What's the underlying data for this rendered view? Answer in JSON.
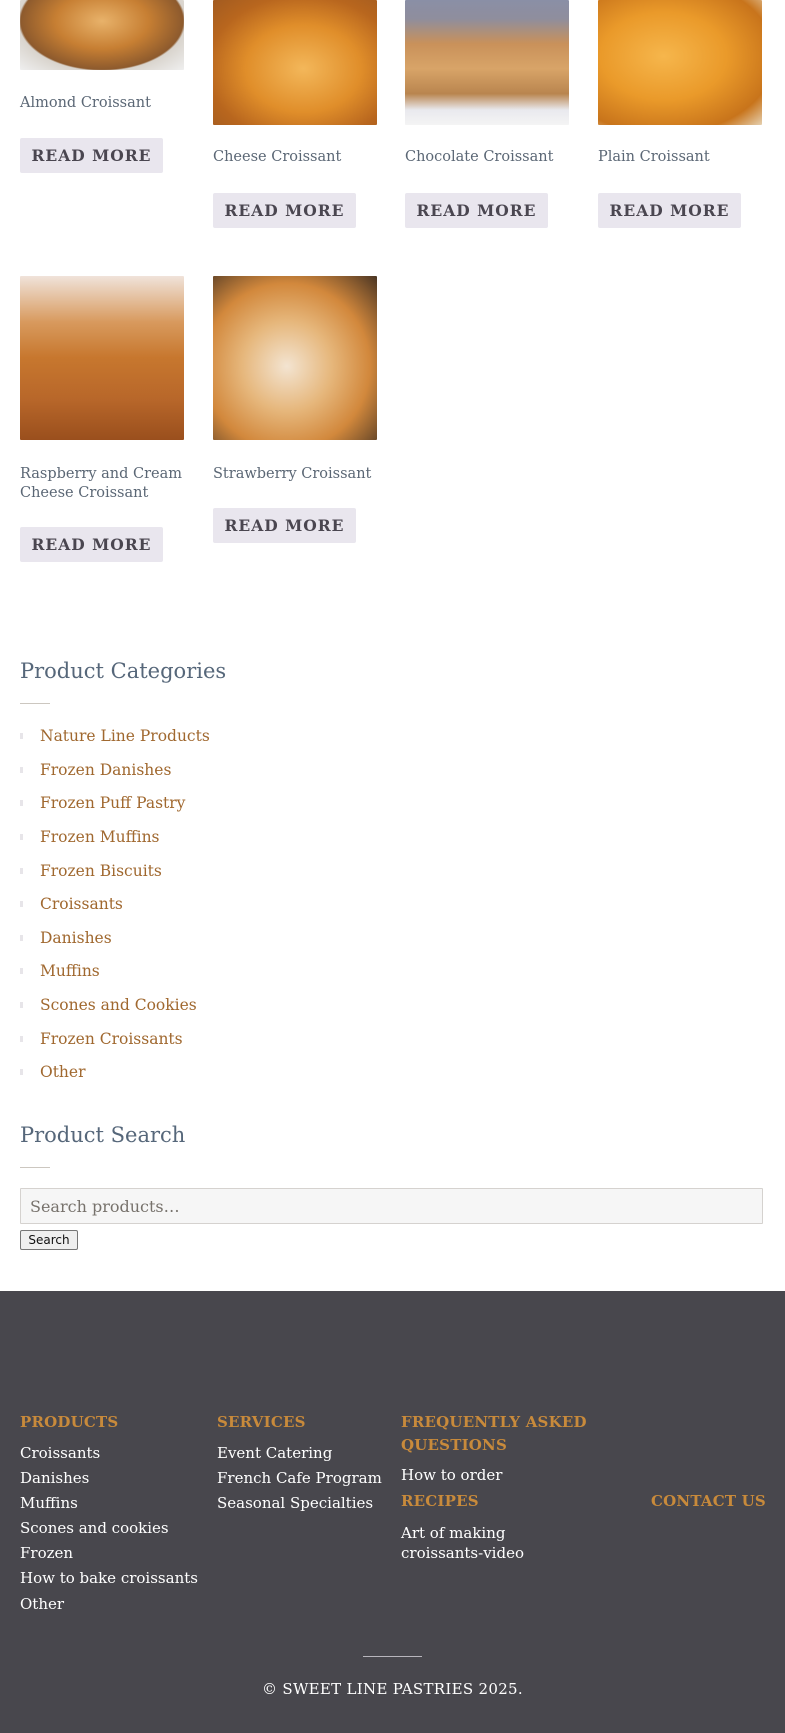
{
  "products": [
    {
      "name": "Almond Croissant",
      "image": "almond-croissant-image",
      "button": "READ MORE"
    },
    {
      "name": "Cheese Croissant",
      "image": "cheese-croissant-image",
      "button": "READ MORE"
    },
    {
      "name": "Chocolate Croissant",
      "image": "chocolate-croissant-image",
      "button": "READ MORE"
    },
    {
      "name": "Plain Croissant",
      "image": "plain-croissant-image",
      "button": "READ MORE"
    },
    {
      "name": "Raspberry and Cream Cheese Croissant",
      "image": "raspberry-cream-cheese-croissant-image",
      "button": "READ MORE"
    },
    {
      "name": "Strawberry Croissant",
      "image": "strawberry-croissant-image",
      "button": "READ MORE"
    }
  ],
  "categories_widget": {
    "title": "Product Categories",
    "items": [
      "Nature Line Products",
      "Frozen Danishes",
      "Frozen Puff Pastry",
      "Frozen Muffins",
      "Frozen Biscuits",
      "Croissants",
      "Danishes",
      "Muffins",
      "Scones and Cookies",
      "Frozen Croissants",
      "Other"
    ]
  },
  "search_widget": {
    "title": "Product Search",
    "placeholder": "Search products…",
    "button": "Search"
  },
  "footer": {
    "products": {
      "heading": "PRODUCTS",
      "links": [
        "Croissants",
        "Danishes",
        "Muffins",
        "Scones and cookies",
        "Frozen",
        "How to bake croissants",
        "Other"
      ]
    },
    "services": {
      "heading": "SERVICES",
      "links": [
        "Event Catering",
        "French Cafe Program",
        "Seasonal Specialties"
      ]
    },
    "faq": {
      "heading": "FREQUENTLY ASKED QUESTIONS",
      "links": [
        "How to order"
      ]
    },
    "recipes": {
      "heading": "RECIPES",
      "links": [
        "Art of making croissants-video"
      ]
    },
    "contact": {
      "heading": "CONTACT US"
    },
    "copyright": "© SWEET LINE PASTRIES 2025."
  },
  "colors": {
    "link_accent": "#a0682f",
    "footer_heading": "#c88a3b",
    "footer_bg": "#48474d",
    "button_bg": "#e9e6ee"
  }
}
